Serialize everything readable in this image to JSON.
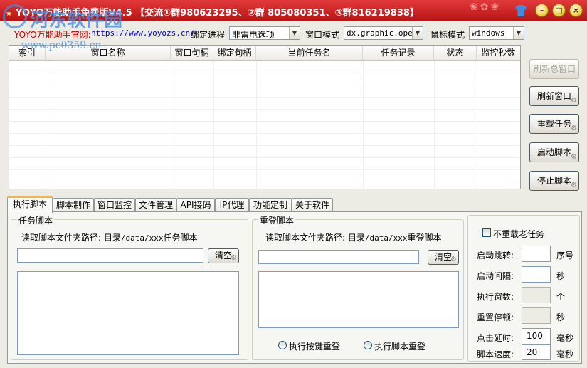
{
  "window": {
    "title": "YOYO万能助手免费版V4.5 【交流①群980623295、②群 805080351、③群816219838】",
    "watermark_main": "河东软件园",
    "watermark_sub": "www.pc0359.cn",
    "minimize": "–",
    "restore": "□",
    "close": "×"
  },
  "top": {
    "site_label": "YOYO万能助手官网:",
    "site_url": "https://www.yoyozs.cn/",
    "bind_label": "绑定进程",
    "bind_value": "非雷电选项",
    "window_mode_label": "窗口模式",
    "window_mode_value": "dx.graphic.open",
    "mouse_mode_label": "鼠标模式",
    "mouse_mode_value": "windows"
  },
  "grid": {
    "columns": [
      "索引",
      "窗口名称",
      "窗口句柄",
      "绑定句柄",
      "当前任务名",
      "任务记录",
      "状态",
      "监控秒数"
    ]
  },
  "buttons": {
    "refresh_all": "刷新总窗口",
    "refresh": "刷新窗口",
    "reload": "重载任务",
    "start": "启动脚本",
    "stop": "停止脚本",
    "clear": "清空"
  },
  "tabs": [
    "执行脚本",
    "脚本制作",
    "窗口监控",
    "文件管理",
    "API接码",
    "IP代理",
    "功能定制",
    "关于软件"
  ],
  "task": {
    "title": "任务脚本",
    "path_prefix": "读取脚本文件夹路径: 目录",
    "path_mono": "/data/xxx",
    "path_suffix": "任务脚本"
  },
  "relogin": {
    "title": "重登脚本",
    "path_prefix": "读取脚本文件夹路径: 目录",
    "path_mono": "/data/xxx",
    "path_suffix": "重登脚本",
    "radio_key": "执行按键重登",
    "radio_script": "执行脚本重登"
  },
  "settings": {
    "no_reload": "不重载老任务",
    "rows": [
      {
        "label": "启动跳转:",
        "value": "",
        "unit": "序号"
      },
      {
        "label": "启动间隔:",
        "value": "",
        "unit": "秒"
      },
      {
        "label": "执行窗数:",
        "value": "",
        "unit": "个"
      },
      {
        "label": "重置停顿:",
        "value": "",
        "unit": "秒"
      },
      {
        "label": "点击延时:",
        "value": "100",
        "unit": "毫秒"
      },
      {
        "label": "脚本速度:",
        "value": "20",
        "unit": "毫秒"
      }
    ]
  },
  "colors": {
    "titlebar": "#d32424",
    "accent_tab": "#f7b441"
  }
}
